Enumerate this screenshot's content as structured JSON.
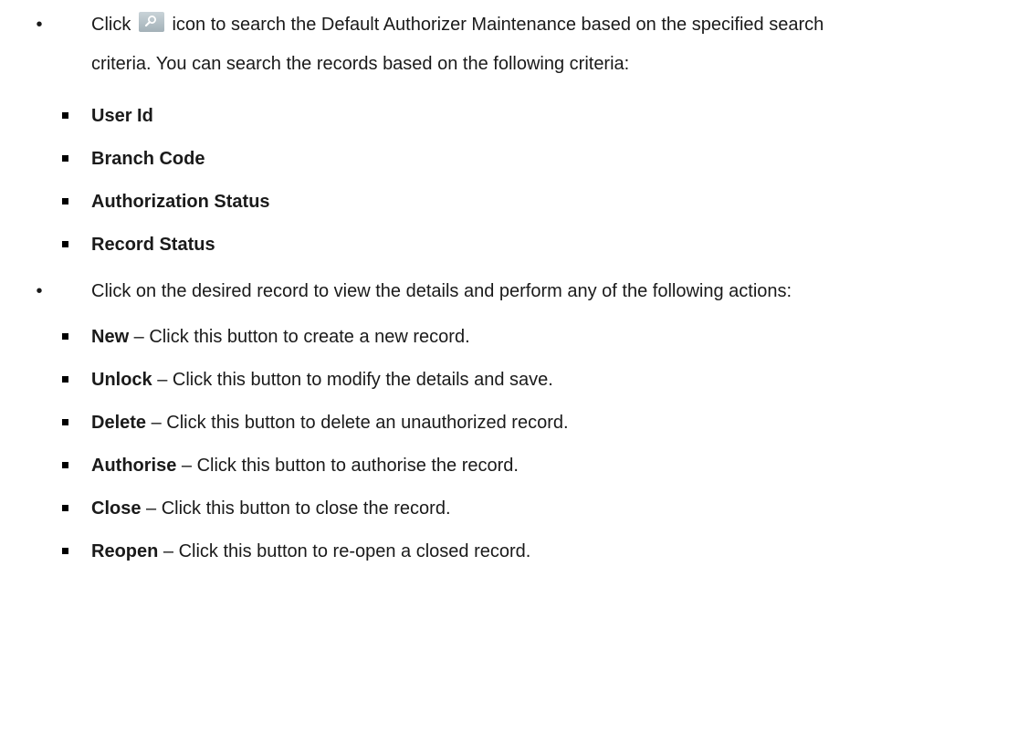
{
  "section1": {
    "click_word": "Click",
    "icon": "search-icon",
    "text_after_icon": "icon to search the Default Authorizer Maintenance based on the specified search",
    "line2": "criteria. You can search the records based on the following criteria:",
    "criteria": [
      {
        "label": "User Id"
      },
      {
        "label": "Branch Code"
      },
      {
        "label": "Authorization Status"
      },
      {
        "label": "Record Status"
      }
    ]
  },
  "section2": {
    "intro": "Click on the desired record to view the details and perform any of the following actions:",
    "actions": [
      {
        "label": "New",
        "desc": " – Click this button to create a new record."
      },
      {
        "label": "Unlock",
        "desc": " – Click this button to modify the details and save."
      },
      {
        "label": "Delete",
        "desc": " – Click this button to delete an unauthorized record."
      },
      {
        "label": "Authorise",
        "desc": " – Click this button to authorise the record."
      },
      {
        "label": "Close",
        "desc": " – Click this button to close the record."
      },
      {
        "label": "Reopen",
        "desc": " – Click this button to re-open a closed record."
      }
    ]
  }
}
